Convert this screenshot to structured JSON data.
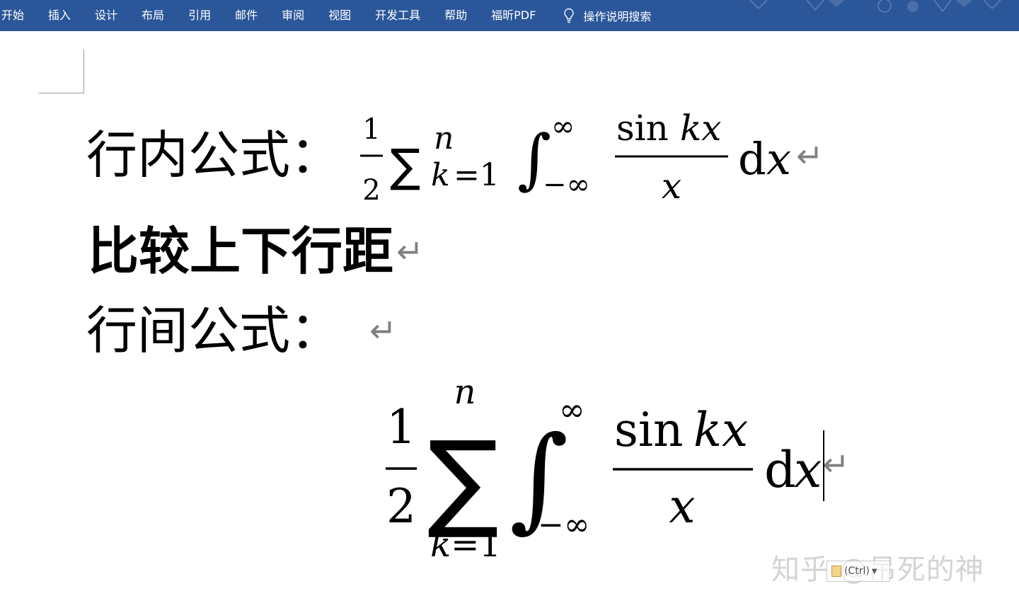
{
  "ribbon": {
    "tabs": [
      {
        "label": "开始"
      },
      {
        "label": "插入"
      },
      {
        "label": "设计"
      },
      {
        "label": "布局"
      },
      {
        "label": "引用"
      },
      {
        "label": "邮件"
      },
      {
        "label": "审阅"
      },
      {
        "label": "视图"
      },
      {
        "label": "开发工具"
      },
      {
        "label": "帮助"
      },
      {
        "label": "福昕PDF"
      }
    ],
    "tell_me": {
      "icon": "lightbulb-icon",
      "label": "操作说明搜索"
    },
    "background": "#2b579a"
  },
  "document": {
    "line1_label": "行内公式：",
    "line2_text": "比较上下行距",
    "line3_label": "行间公式：",
    "paragraph_mark": "↵"
  },
  "formula": {
    "one": "1",
    "two": "2",
    "sigma": "∑",
    "n": "n",
    "k": "k",
    "eq_one": "=1",
    "integral": "∫",
    "infinity": "∞",
    "neg_infinity": "−∞",
    "sin": "sin",
    "kx": "kx",
    "x": "x",
    "d": "d"
  },
  "watermark": "知乎 @吊死的神",
  "paste_options": "(Ctrl)"
}
